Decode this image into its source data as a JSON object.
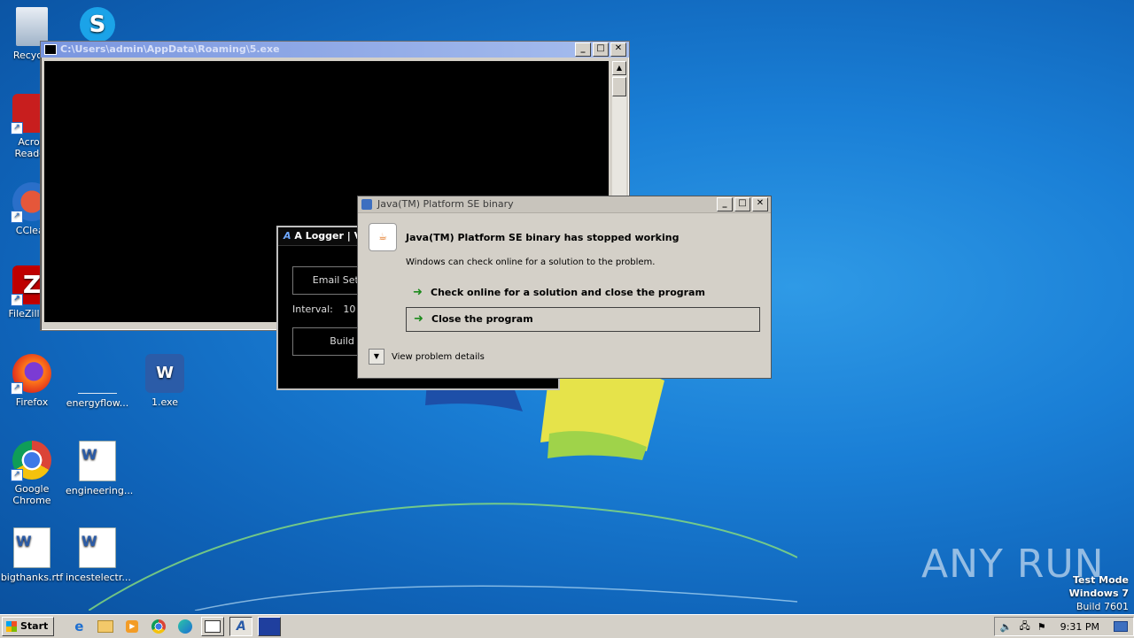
{
  "desktop": {
    "icons": [
      {
        "label": "Recycle",
        "icon": "recycle-bin-icon"
      },
      {
        "label": "",
        "icon": "skype-icon"
      },
      {
        "label": "Acrob Reader",
        "icon": "acrobat-icon"
      },
      {
        "label": "CClear",
        "icon": "ccleaner-icon"
      },
      {
        "label": "FileZilla C",
        "icon": "filezilla-icon"
      },
      {
        "label": "Firefox",
        "icon": "firefox-icon"
      },
      {
        "label": "energyflow...",
        "icon": "blank-file-icon"
      },
      {
        "label": "1.exe",
        "icon": "word-shield-icon"
      },
      {
        "label": "Google Chrome",
        "icon": "chrome-icon"
      },
      {
        "label": "engineering...",
        "icon": "word-doc-icon"
      },
      {
        "label": "bigthanks.rtf",
        "icon": "word-doc-icon"
      },
      {
        "label": "incestelectr...",
        "icon": "word-doc-icon"
      }
    ]
  },
  "console": {
    "title": "C:\\Users\\admin\\AppData\\Roaming\\5.exe"
  },
  "logger": {
    "title": "A Logger | V",
    "email_button": "Email Settin",
    "interval_label": "Interval:",
    "interval_value": "10",
    "build_button": "Build"
  },
  "dialog": {
    "title": "Java(TM) Platform SE binary",
    "heading": "Java(TM) Platform SE binary has stopped working",
    "subtext": "Windows can check online for a solution to the problem.",
    "option_check": "Check online for a solution and close the program",
    "option_close": "Close the program",
    "details": "View problem details"
  },
  "taskbar": {
    "start_label": "Start",
    "clock": "9:31 PM"
  },
  "watermark": "ANY RUN",
  "test_mode": {
    "line1": "Test Mode",
    "line2": "Windows 7",
    "line3": "Build 7601"
  }
}
